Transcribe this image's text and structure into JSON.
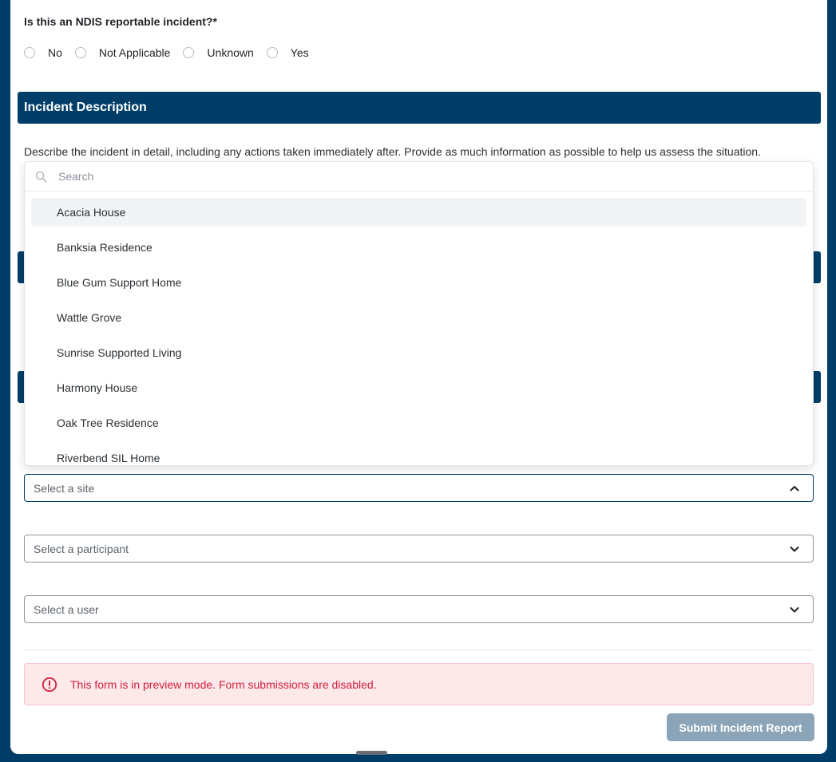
{
  "ndis_question": {
    "label": "Is this an NDIS reportable incident?",
    "required_mark": "*",
    "options": [
      "No",
      "Not Applicable",
      "Unknown",
      "Yes"
    ]
  },
  "incident_section": {
    "title": "Incident Description",
    "description": "Describe the incident in detail, including any actions taken immediately after. Provide as much information as possible to help us assess the situation."
  },
  "site_dropdown": {
    "search_placeholder": "Search",
    "items": [
      "Acacia House",
      "Banksia Residence",
      "Blue Gum Support Home",
      "Wattle Grove",
      "Sunrise Supported Living",
      "Harmony House",
      "Oak Tree Residence",
      "Riverbend SIL Home"
    ],
    "highlighted_item": "Acacia House"
  },
  "selects": {
    "site_placeholder": "Select a site",
    "participant_placeholder": "Select a participant",
    "user_placeholder": "Select a user"
  },
  "alert": {
    "message": "This form is in preview mode. Form submissions are disabled.",
    "color": "#d21f3c"
  },
  "submit": {
    "label": "Submit Incident Report"
  },
  "colors": {
    "brand": "#003e69",
    "submit_disabled": "#8ba4b7",
    "alert_bg": "#fde8ea"
  },
  "icons": {
    "search": "search-icon",
    "chevron_up": "chevron-up-icon",
    "chevron_down": "chevron-down-icon",
    "alert": "alert-circle-icon"
  }
}
